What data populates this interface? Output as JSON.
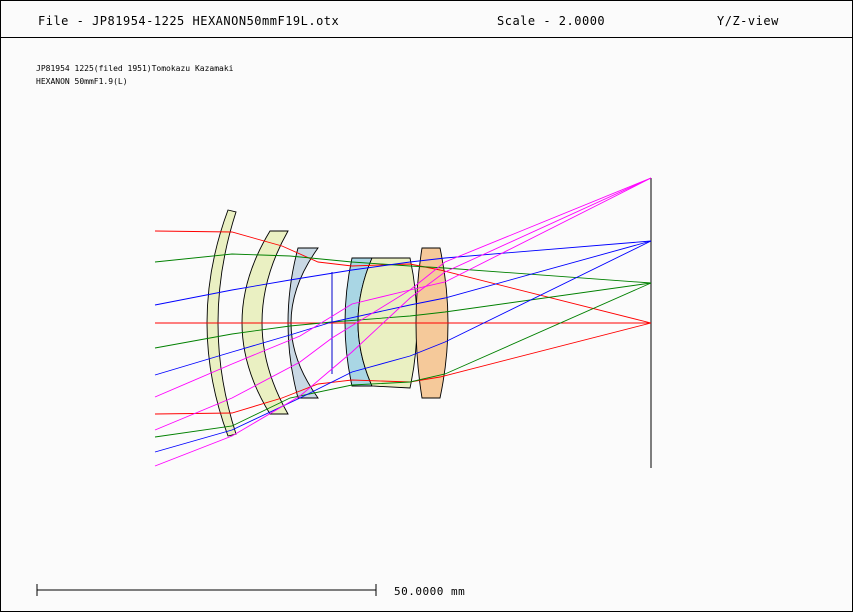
{
  "header": {
    "file_label": "File - JP81954-1225 HEXANON50mmF19L.otx",
    "scale_label": "Scale - 2.0000",
    "view_label": "Y/Z-view"
  },
  "description": {
    "line1": "JP81954 1225(filed 1951)Tomokazu Kazamaki",
    "line2": "HEXANON 50mmF1.9(L)"
  },
  "scale_bar": {
    "label": "50.0000 mm"
  },
  "colors": {
    "ray_axial": "#ff0000",
    "ray_field_mid": "#008000",
    "ray_field_high": "#0000ff",
    "ray_field_max": "#ff00ff",
    "element_1": "#eaf0c2",
    "element_2": "#eaf0c2",
    "element_3": "#c9d8e4",
    "element_4": "#a9d6e4",
    "element_5": "#eaf0c2",
    "element_6": "#f5c99a"
  }
}
